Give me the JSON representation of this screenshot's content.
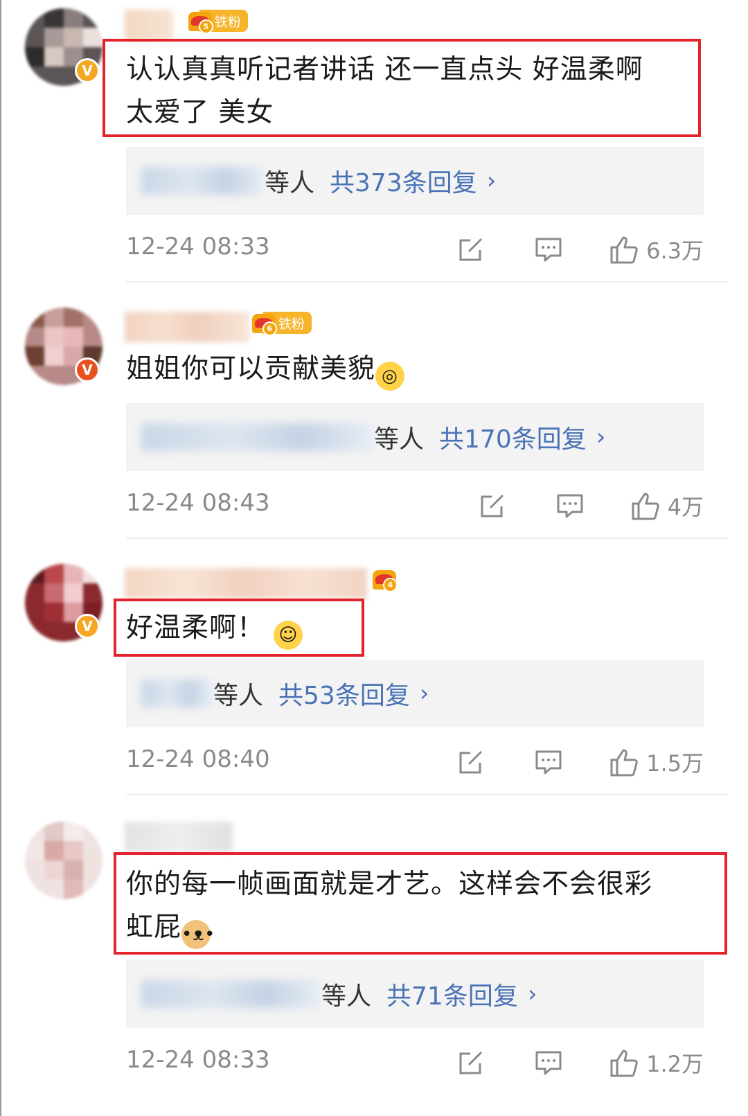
{
  "comments": [
    {
      "fan_level": "5",
      "fan_label": "铁粉",
      "text_line1": "认认真真听记者讲话 还一直点头 好温柔啊",
      "text_line2": "太爱了 美女",
      "reply_who": "等人",
      "reply_count": "共373条回复",
      "reply_chevron": "›",
      "time": "12-24 08:33",
      "likes": "6.3万",
      "badge": "V"
    },
    {
      "fan_level": "6",
      "fan_label": "铁粉",
      "text_line1": "姐姐你可以贡献美貌",
      "reply_who": "等人",
      "reply_count": "共170条回复",
      "reply_chevron": "›",
      "time": "12-24 08:43",
      "likes": "4万",
      "badge": "V"
    },
    {
      "fan_level": "4",
      "text_line1": "好温柔啊！",
      "reply_who": "等人",
      "reply_count": "共53条回复",
      "reply_chevron": "›",
      "time": "12-24 08:40",
      "likes": "1.5万",
      "badge": "V"
    },
    {
      "text_line1": "你的每一帧画面就是才艺。这样会不会很彩",
      "text_line2": "虹屁",
      "reply_who": "等人",
      "reply_count": "共71条回复",
      "reply_chevron": "›",
      "time": "12-24 08:33",
      "likes": "1.2万"
    }
  ],
  "icons": [
    "edit-icon",
    "comment-icon",
    "like-icon"
  ],
  "colors": {
    "highlight_box": "#e3232c",
    "link": "#4a73b6",
    "meta_text": "#8a8a8a",
    "fan_badge": "#f6b42a"
  }
}
